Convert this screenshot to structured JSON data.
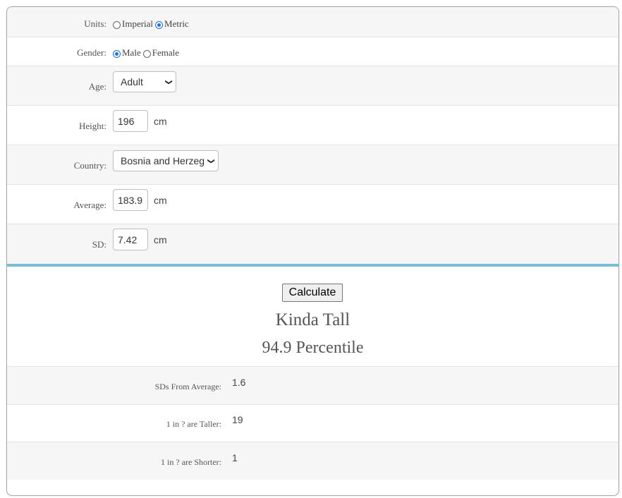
{
  "form": {
    "units": {
      "label": "Units:",
      "options": [
        "Imperial",
        "Metric"
      ],
      "selected": "Metric"
    },
    "gender": {
      "label": "Gender:",
      "options": [
        "Male",
        "Female"
      ],
      "selected": "Male"
    },
    "age": {
      "label": "Age:",
      "value": "Adult"
    },
    "height": {
      "label": "Height:",
      "value": "196",
      "unit": "cm"
    },
    "country": {
      "label": "Country:",
      "value": "Bosnia and Herzeg"
    },
    "average": {
      "label": "Average:",
      "value": "183.9",
      "unit": "cm"
    },
    "sd": {
      "label": "SD:",
      "value": "7.42",
      "unit": "cm"
    }
  },
  "calculate_label": "Calculate",
  "result": {
    "verdict": "Kinda Tall",
    "percentile": "94.9 Percentile"
  },
  "stats": [
    {
      "label": "SDs From Average:",
      "value": "1.6"
    },
    {
      "label": "1 in ? are Taller:",
      "value": "19"
    },
    {
      "label": "1 in ? are Shorter:",
      "value": "1"
    }
  ],
  "colors": {
    "accent": "#78bcd8",
    "radio": "#1a73e8"
  }
}
